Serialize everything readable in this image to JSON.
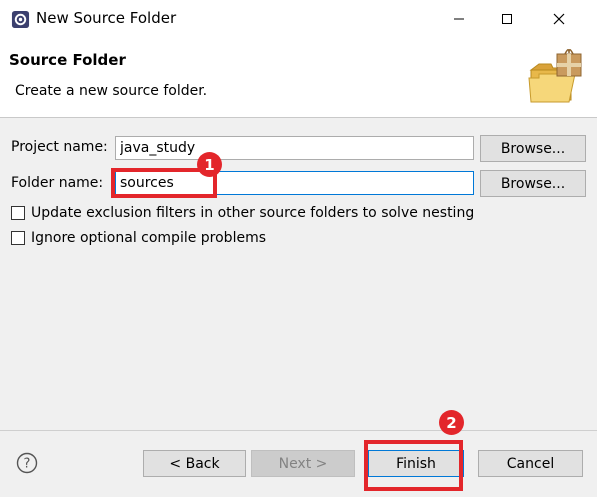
{
  "window": {
    "title": "New Source Folder",
    "icon": "eclipse-gear-icon",
    "minimize_icon": "minimize-icon",
    "maximize_icon": "maximize-icon",
    "close_icon": "close-icon"
  },
  "header": {
    "title": "Source Folder",
    "description": "Create a new source folder.",
    "graphic": "folder-package-icon"
  },
  "form": {
    "project_label": "Project name:",
    "project_value": "java_study",
    "folder_label": "Folder name:",
    "folder_value": "sources",
    "browse_label": "Browse..."
  },
  "options": {
    "update_exclusion": {
      "label": "Update exclusion filters in other source folders to solve nesting",
      "checked": false
    },
    "ignore_compile": {
      "label": "Ignore optional compile problems",
      "checked": false
    }
  },
  "footer": {
    "help_icon": "help-question-icon",
    "back_label": "< Back",
    "next_label": "Next >",
    "finish_label": "Finish",
    "cancel_label": "Cancel"
  },
  "annotations": {
    "step1": "1",
    "step2": "2",
    "color": "#e3262b"
  }
}
